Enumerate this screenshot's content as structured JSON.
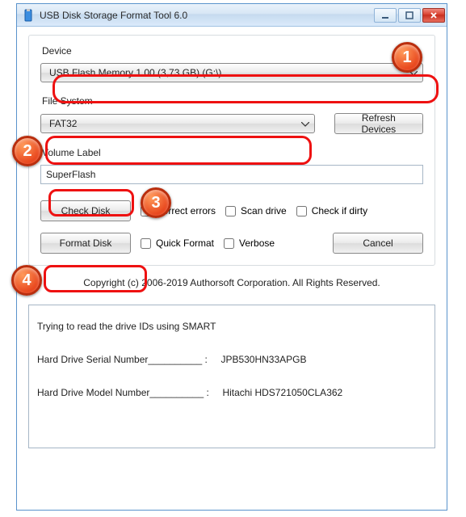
{
  "window": {
    "title": "USB Disk Storage Format Tool 6.0"
  },
  "labels": {
    "device": "Device",
    "filesystem": "File System",
    "volume": "Volume Label"
  },
  "device": {
    "selected": "USB Flash Memory  1.00 (3,73 GB) (G:\\)"
  },
  "filesystem": {
    "selected": "FAT32"
  },
  "volume": {
    "value": "SuperFlash"
  },
  "buttons": {
    "refresh": "Refresh Devices",
    "check": "Check Disk",
    "format": "Format Disk",
    "cancel": "Cancel"
  },
  "checks": {
    "correct": "Correct errors",
    "scan": "Scan drive",
    "dirty": "Check if dirty",
    "quick": "Quick Format",
    "verbose": "Verbose"
  },
  "copyright": "Copyright (c) 2006-2019 Authorsoft Corporation. All Rights Reserved.",
  "log": {
    "line1": "Trying to read the drive IDs using SMART",
    "line2": "Hard Drive Serial Number__________ :     JPB530HN33APGB",
    "line3": "Hard Drive Model Number__________ :     Hitachi HDS721050CLA362"
  },
  "callouts": {
    "c1": "1",
    "c2": "2",
    "c3": "3",
    "c4": "4"
  }
}
